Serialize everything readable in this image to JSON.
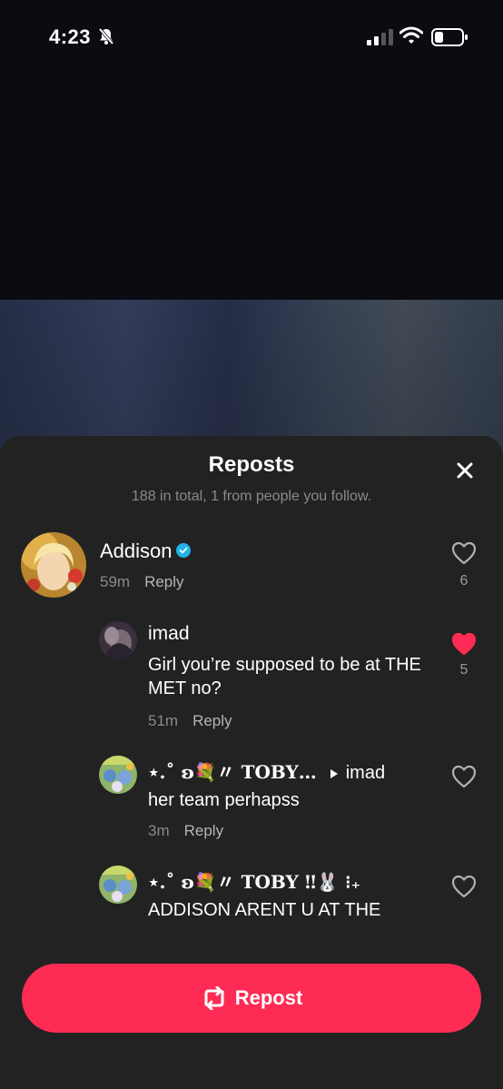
{
  "status_bar": {
    "time": "4:23"
  },
  "sheet": {
    "title": "Reposts",
    "subtitle": "188 in total, 1 from people you follow."
  },
  "comments": [
    {
      "username": "Addison",
      "verified": true,
      "time": "59m",
      "reply_label": "Reply",
      "likes": "6",
      "liked": false
    },
    {
      "username": "imad",
      "text": "Girl you’re supposed to be at THE MET no?",
      "time": "51m",
      "reply_label": "Reply",
      "likes": "5",
      "liked": true
    },
    {
      "username": "⋆.˚ ʚ💐〃 TOBY…",
      "reply_to": "imad",
      "text": "her team perhapss",
      "time": "3m",
      "reply_label": "Reply",
      "liked": false
    },
    {
      "username": "⋆.˚ ʚ💐〃 TOBY ‼🐰 ⁝₊",
      "text": "ADDISON ARENT U AT THE MET GALA",
      "liked": false
    }
  ],
  "repost_button": {
    "label": "Repost"
  },
  "colors": {
    "accent": "#fe2c55",
    "verified": "#20b4e8",
    "sheet_bg": "#222222"
  },
  "icons": [
    "bell-slash-icon",
    "signal-icon",
    "wifi-icon",
    "battery-icon",
    "close-icon",
    "verified-icon",
    "heart-icon",
    "heart-filled-icon",
    "play-arrow-icon",
    "repost-icon"
  ]
}
